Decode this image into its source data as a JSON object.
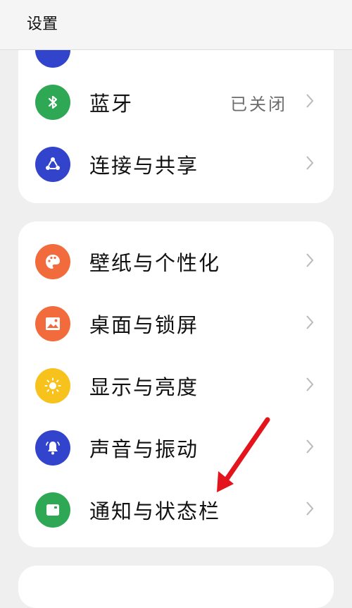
{
  "header": {
    "title": "设置"
  },
  "card1": {
    "items": [
      {
        "label": "蓝牙",
        "value": "已关闭",
        "icon": "bluetooth-icon",
        "color": "#2ea855"
      },
      {
        "label": "连接与共享",
        "icon": "share-icon",
        "color": "#3344cc"
      }
    ],
    "partial_icon_color": "#3344cc"
  },
  "card2": {
    "items": [
      {
        "label": "壁纸与个性化",
        "icon": "palette-icon",
        "color": "#f26b3d"
      },
      {
        "label": "桌面与锁屏",
        "icon": "picture-icon",
        "color": "#f26b3d"
      },
      {
        "label": "显示与亮度",
        "icon": "sun-icon",
        "color": "#f8c21c"
      },
      {
        "label": "声音与振动",
        "icon": "bell-icon",
        "color": "#3344cc"
      },
      {
        "label": "通知与状态栏",
        "icon": "notification-icon",
        "color": "#2ea855"
      }
    ]
  },
  "annotation": {
    "arrow_color": "#e3141c"
  }
}
